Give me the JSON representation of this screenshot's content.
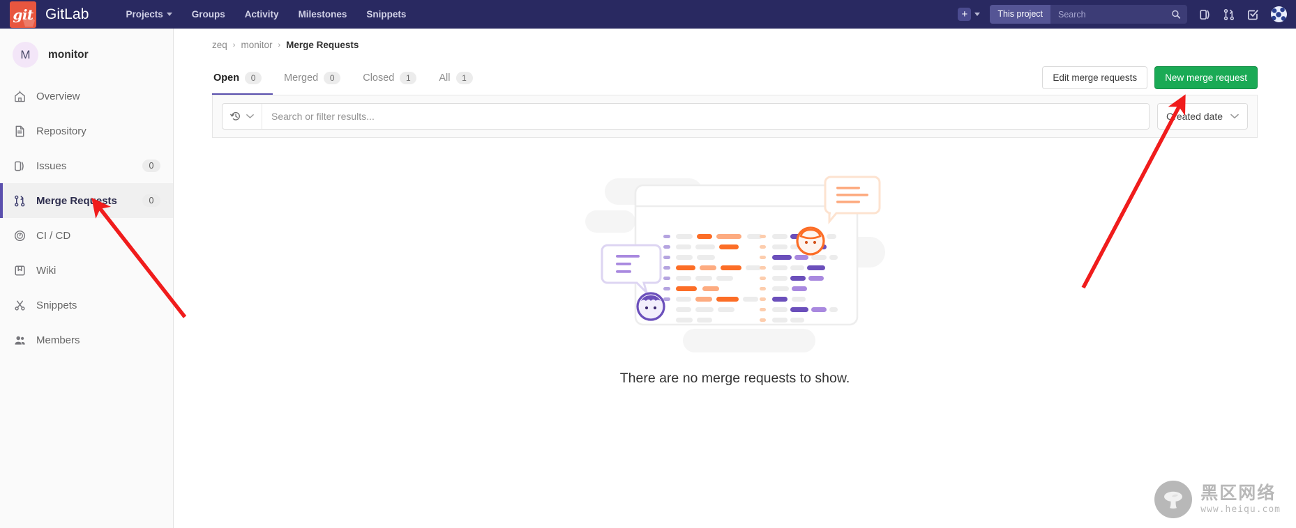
{
  "topnav": {
    "brand": "GitLab",
    "logo_text": "git",
    "links": [
      {
        "label": "Projects",
        "has_caret": true
      },
      {
        "label": "Groups",
        "has_caret": false
      },
      {
        "label": "Activity",
        "has_caret": false
      },
      {
        "label": "Milestones",
        "has_caret": false
      },
      {
        "label": "Snippets",
        "has_caret": false
      }
    ],
    "plus_icon": "plus-icon",
    "search": {
      "scope": "This project",
      "placeholder": "Search",
      "value": "",
      "icon": "search-icon"
    },
    "icons": [
      {
        "name": "issues-icon"
      },
      {
        "name": "merge-request-icon"
      },
      {
        "name": "todos-checkbox-icon"
      }
    ],
    "avatar": "user-avatar",
    "bg_color": "#292961",
    "logo_bg": "#e8563f"
  },
  "sidebar": {
    "project": {
      "initial": "M",
      "name": "monitor"
    },
    "items": [
      {
        "label": "Overview",
        "icon": "home-icon",
        "badge": null,
        "active": false
      },
      {
        "label": "Repository",
        "icon": "document-icon",
        "badge": null,
        "active": false
      },
      {
        "label": "Issues",
        "icon": "issues-icon",
        "badge": "0",
        "active": false
      },
      {
        "label": "Merge Requests",
        "icon": "merge-request-icon",
        "badge": "0",
        "active": true
      },
      {
        "label": "CI / CD",
        "icon": "rocket-gauge-icon",
        "badge": null,
        "active": false
      },
      {
        "label": "Wiki",
        "icon": "book-icon",
        "badge": null,
        "active": false
      },
      {
        "label": "Snippets",
        "icon": "scissors-icon",
        "badge": null,
        "active": false
      },
      {
        "label": "Members",
        "icon": "users-icon",
        "badge": null,
        "active": false
      }
    ],
    "active_accent": "#5a4fad"
  },
  "breadcrumb": {
    "group": "zeq",
    "project": "monitor",
    "current": "Merge Requests",
    "separator": "›"
  },
  "tabs": [
    {
      "label": "Open",
      "count": "0",
      "active": true
    },
    {
      "label": "Merged",
      "count": "0",
      "active": false
    },
    {
      "label": "Closed",
      "count": "1",
      "active": false
    },
    {
      "label": "All",
      "count": "1",
      "active": false
    }
  ],
  "actions": {
    "edit_label": "Edit merge requests",
    "new_label": "New merge request",
    "new_color": "#1aaa55"
  },
  "filter": {
    "history_icon": "history-icon",
    "chevron_icon": "chevron-down-icon",
    "placeholder": "Search or filter results...",
    "value": "",
    "sort_label": "Created date",
    "sort_chevron": "chevron-down-icon"
  },
  "empty_state": {
    "message": "There are no merge requests to show.",
    "illustration": "merge-request-empty-illustration",
    "colors": {
      "orange": "#fc6d26",
      "orange_light": "#fca326",
      "purple": "#6b4fbb",
      "purple_light": "#a989df",
      "grey": "#eeeeee"
    }
  },
  "watermark": {
    "cn_text": "黑区网络",
    "url": "www.heiqu.com",
    "logo": "mushroom-logo"
  },
  "annotations": {
    "arrow_color": "#f01c1c",
    "arrows": [
      {
        "name": "arrow-to-merge-requests-sidebar",
        "points_to": "Merge Requests"
      },
      {
        "name": "arrow-to-new-merge-request-button",
        "points_to": "New merge request"
      }
    ]
  }
}
